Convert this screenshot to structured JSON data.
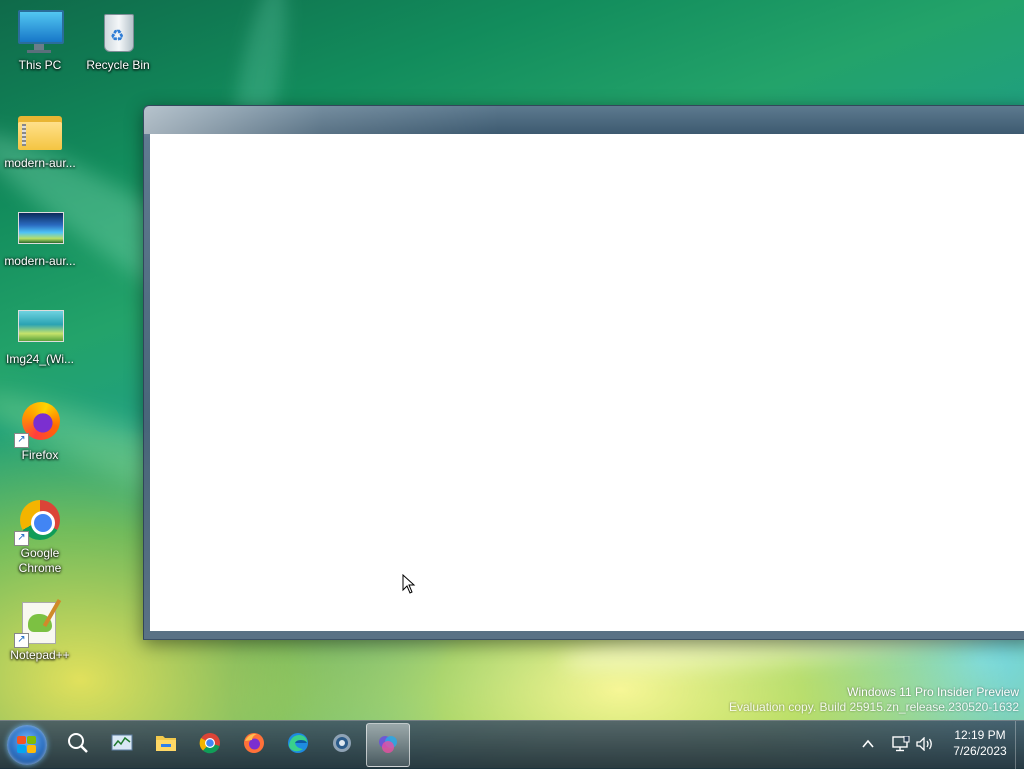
{
  "desktop": {
    "icons": [
      {
        "label": "This PC",
        "icon": "computer-icon"
      },
      {
        "label": "Recycle Bin",
        "icon": "recycle-bin-icon"
      },
      {
        "label": "modern-aur...",
        "icon": "zip-folder-icon"
      },
      {
        "label": "modern-aur...",
        "icon": "image-file-icon"
      },
      {
        "label": "Img24_(Wi...",
        "icon": "image-file-icon"
      },
      {
        "label": "Firefox",
        "icon": "firefox-icon"
      },
      {
        "label": "Google Chrome",
        "icon": "chrome-icon"
      },
      {
        "label": "Notepad++",
        "icon": "notepad-plus-plus-icon"
      }
    ]
  },
  "watermark": {
    "line1": "Windows 11 Pro Insider Preview",
    "line2": "Evaluation copy. Build 25915.zn_release.230520-1632"
  },
  "taskbar": {
    "items": [
      {
        "name": "start-button",
        "icon": "windows-logo-icon"
      },
      {
        "name": "search-button",
        "icon": "search-icon"
      },
      {
        "name": "task-manager",
        "icon": "task-manager-icon"
      },
      {
        "name": "file-explorer",
        "icon": "folder-icon"
      },
      {
        "name": "chrome",
        "icon": "chrome-icon"
      },
      {
        "name": "firefox",
        "icon": "firefox-icon"
      },
      {
        "name": "edge",
        "icon": "edge-icon"
      },
      {
        "name": "settings",
        "icon": "gear-icon"
      },
      {
        "name": "active-app",
        "icon": "app-icon",
        "active": true
      }
    ],
    "tray": {
      "icons": [
        "chevron-up-icon",
        "network-icon",
        "volume-icon"
      ]
    },
    "clock": {
      "time": "12:19 PM",
      "date": "7/26/2023"
    }
  },
  "colors": {
    "taskbar": "#2c4155",
    "window_frame": "#4f6a80",
    "client_bg": "#ffffff"
  }
}
